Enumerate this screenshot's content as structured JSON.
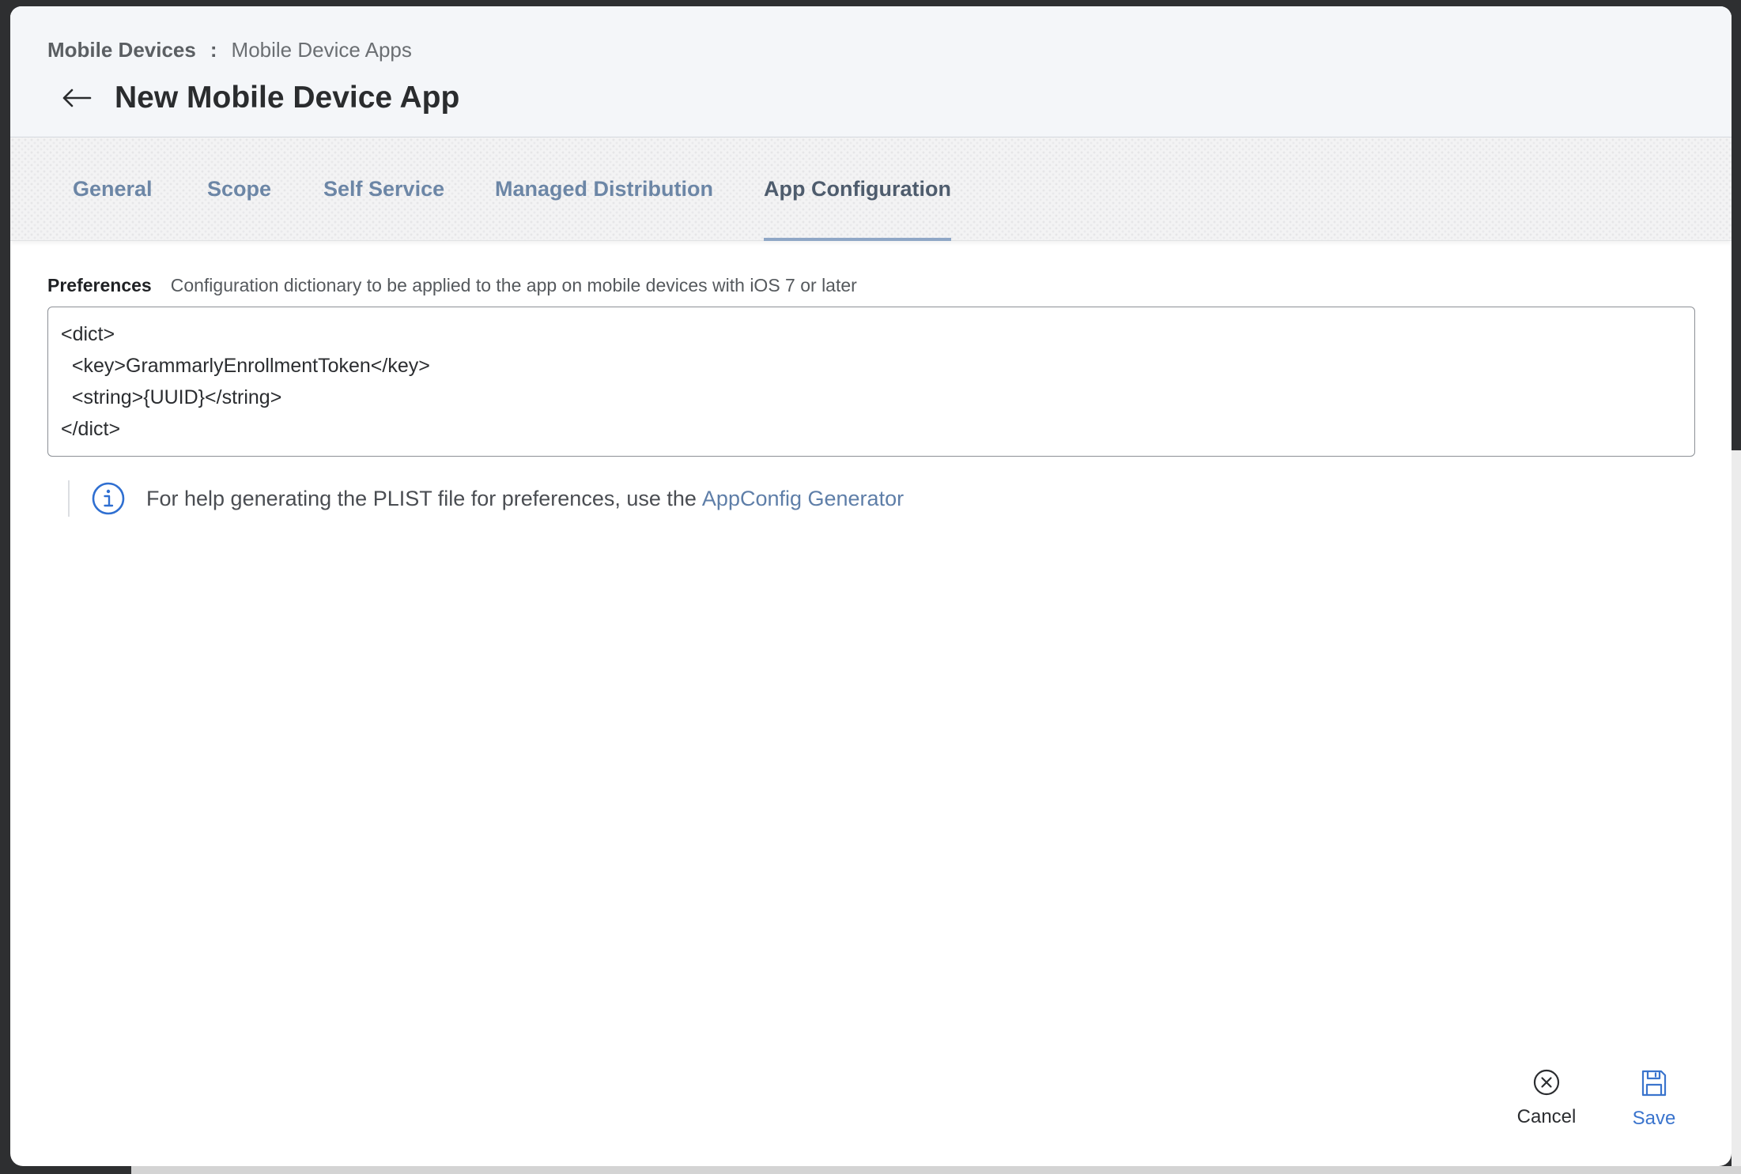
{
  "breadcrumb": {
    "parent": "Mobile Devices",
    "separator": ":",
    "current": "Mobile Device Apps"
  },
  "page_title": "New Mobile Device App",
  "tabs": [
    {
      "label": "General",
      "active": false
    },
    {
      "label": "Scope",
      "active": false
    },
    {
      "label": "Self Service",
      "active": false
    },
    {
      "label": "Managed Distribution",
      "active": false
    },
    {
      "label": "App Configuration",
      "active": true
    }
  ],
  "preferences": {
    "label": "Preferences",
    "description": "Configuration dictionary to be applied to the app on mobile devices with iOS 7 or later",
    "value": "<dict>\n  <key>GrammarlyEnrollmentToken</key>\n  <string>{UUID}</string>\n</dict>"
  },
  "help": {
    "text": "For help generating the PLIST file for preferences, use the",
    "link_label": "AppConfig Generator"
  },
  "footer": {
    "cancel_label": "Cancel",
    "save_label": "Save"
  },
  "colors": {
    "accent": "#3a74cd",
    "tab_text": "#6c86a6",
    "tab_active_text": "#4e5c6d",
    "tab_underline": "#8fa7c6",
    "link": "#5e7ea8",
    "info_icon": "#2f6fd1"
  },
  "icons": {
    "back": "arrow-left-icon",
    "info": "info-circle-icon",
    "cancel": "close-circle-icon",
    "save": "save-floppy-icon"
  }
}
